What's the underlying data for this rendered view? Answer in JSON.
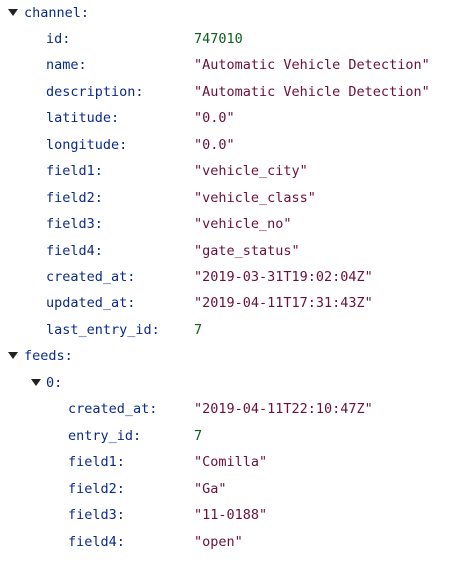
{
  "channel": {
    "key": "channel:",
    "fields": [
      {
        "key": "id:",
        "value": "747010",
        "type": "num"
      },
      {
        "key": "name:",
        "value": "\"Automatic Vehicle Detection\"",
        "type": "str"
      },
      {
        "key": "description:",
        "value": "\"Automatic Vehicle Detection\"",
        "type": "str"
      },
      {
        "key": "latitude:",
        "value": "\"0.0\"",
        "type": "str"
      },
      {
        "key": "longitude:",
        "value": "\"0.0\"",
        "type": "str"
      },
      {
        "key": "field1:",
        "value": "\"vehicle_city\"",
        "type": "str"
      },
      {
        "key": "field2:",
        "value": "\"vehicle_class\"",
        "type": "str"
      },
      {
        "key": "field3:",
        "value": "\"vehicle_no\"",
        "type": "str"
      },
      {
        "key": "field4:",
        "value": "\"gate_status\"",
        "type": "str"
      },
      {
        "key": "created_at:",
        "value": "\"2019-03-31T19:02:04Z\"",
        "type": "str"
      },
      {
        "key": "updated_at:",
        "value": "\"2019-04-11T17:31:43Z\"",
        "type": "str"
      },
      {
        "key": "last_entry_id:",
        "value": "7",
        "type": "num"
      }
    ]
  },
  "feeds": {
    "key": "feeds:",
    "items": [
      {
        "key": "0:",
        "fields": [
          {
            "key": "created_at:",
            "value": "\"2019-04-11T22:10:47Z\"",
            "type": "str"
          },
          {
            "key": "entry_id:",
            "value": "7",
            "type": "num"
          },
          {
            "key": "field1:",
            "value": "\"Comilla\"",
            "type": "str"
          },
          {
            "key": "field2:",
            "value": "\"Ga\"",
            "type": "str"
          },
          {
            "key": "field3:",
            "value": "\"11-0188\"",
            "type": "str"
          },
          {
            "key": "field4:",
            "value": "\"open\"",
            "type": "str"
          }
        ]
      }
    ]
  },
  "colors": {
    "key": "#0a2a8a",
    "string": "#6b0f3a",
    "number": "#0b5d1e",
    "toggle": "#222222"
  },
  "icons": {
    "expand": "triangle-down-icon"
  }
}
